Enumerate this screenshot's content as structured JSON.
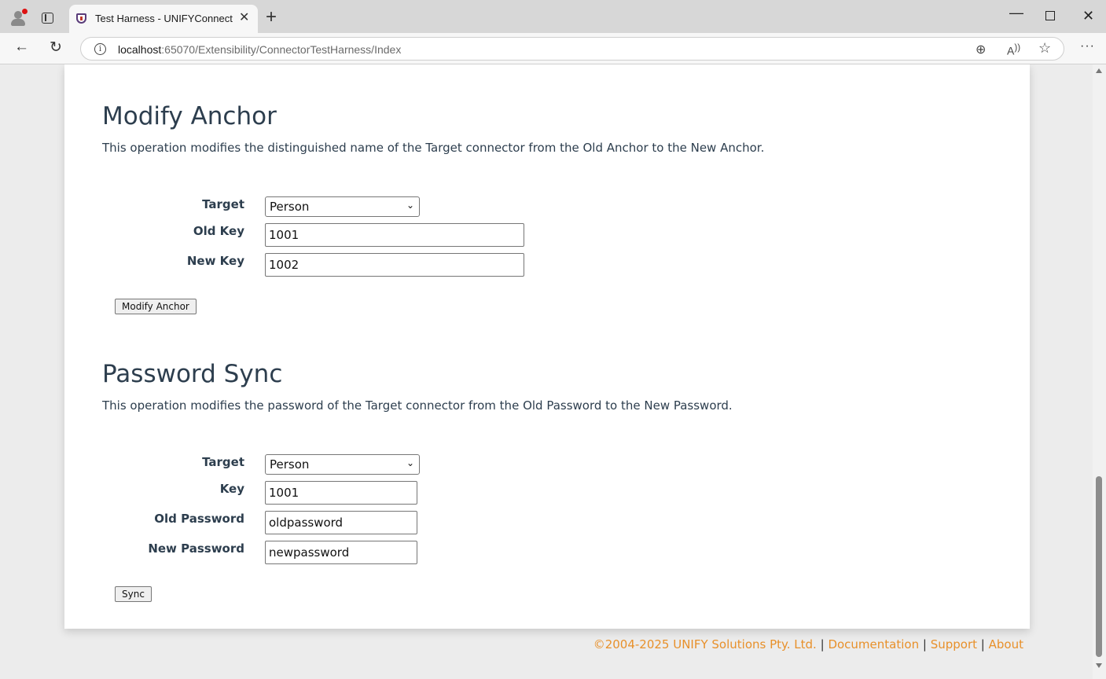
{
  "browser": {
    "tab_title": "Test Harness - UNIFYConnect",
    "url_host": "localhost",
    "url_path": ":65070/Extensibility/ConnectorTestHarness/Index"
  },
  "modify_anchor": {
    "title": "Modify Anchor",
    "description": "This operation modifies the distinguished name of the Target connector from the Old Anchor to the New Anchor.",
    "target_label": "Target",
    "target_value": "Person",
    "old_key_label": "Old Key",
    "old_key_value": "1001",
    "new_key_label": "New Key",
    "new_key_value": "1002",
    "button_label": "Modify Anchor"
  },
  "password_sync": {
    "title": "Password Sync",
    "description": "This operation modifies the password of the Target connector from the Old Password to the New Password.",
    "target_label": "Target",
    "target_value": "Person",
    "key_label": "Key",
    "key_value": "1001",
    "old_password_label": "Old Password",
    "old_password_value": "oldpassword",
    "new_password_label": "New Password",
    "new_password_value": "newpassword",
    "button_label": "Sync"
  },
  "footer": {
    "copyright": "©2004-2025 UNIFY Solutions Pty. Ltd.",
    "separator": "|",
    "documentation": "Documentation",
    "support": "Support",
    "about": "About"
  },
  "colors": {
    "link": "#e8902a",
    "heading": "#2d3e4e"
  }
}
